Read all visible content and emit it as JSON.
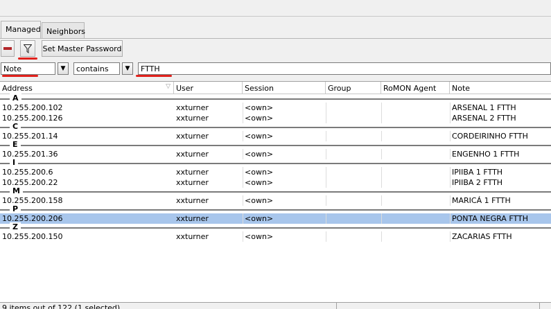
{
  "tabs": [
    {
      "label": "Managed",
      "active": true
    },
    {
      "label": "Neighbors",
      "active": false
    }
  ],
  "toolbar": {
    "remove_icon": "minus-icon",
    "filter_icon": "filter-funnel-icon",
    "master_password_label": "Set Master Password"
  },
  "filter": {
    "field": "Note",
    "operator": "contains",
    "value": "FTTH",
    "dropdown_icon": "dropdown-arrow-icon"
  },
  "table": {
    "columns": [
      "Address",
      "User",
      "Session",
      "Group",
      "RoMON Agent",
      "Note"
    ],
    "groups": [
      {
        "letter": "A",
        "rows": [
          {
            "address": "10.255.200.102",
            "user": "xxturner",
            "session": "<own>",
            "group": "",
            "romon": "",
            "note": "ARSENAL 1 FTTH"
          },
          {
            "address": "10.255.200.126",
            "user": "xxturner",
            "session": "<own>",
            "group": "",
            "romon": "",
            "note": "ARSENAL 2 FTTH"
          }
        ]
      },
      {
        "letter": "C",
        "rows": [
          {
            "address": "10.255.201.14",
            "user": "xxturner",
            "session": "<own>",
            "group": "",
            "romon": "",
            "note": "CORDEIRINHO  FTTH"
          }
        ]
      },
      {
        "letter": "E",
        "rows": [
          {
            "address": "10.255.201.36",
            "user": "xxturner",
            "session": "<own>",
            "group": "",
            "romon": "",
            "note": "ENGENHO 1 FTTH"
          }
        ]
      },
      {
        "letter": "I",
        "rows": [
          {
            "address": "10.255.200.6",
            "user": "xxturner",
            "session": "<own>",
            "group": "",
            "romon": "",
            "note": "IPIIBA  1 FTTH"
          },
          {
            "address": "10.255.200.22",
            "user": "xxturner",
            "session": "<own>",
            "group": "",
            "romon": "",
            "note": "IPIIBA  2 FTTH"
          }
        ]
      },
      {
        "letter": "M",
        "rows": [
          {
            "address": "10.255.200.158",
            "user": "xxturner",
            "session": "<own>",
            "group": "",
            "romon": "",
            "note": "MARICÁ 1 FTTH"
          }
        ]
      },
      {
        "letter": "P",
        "rows": [
          {
            "address": "10.255.200.206",
            "user": "xxturner",
            "session": "<own>",
            "group": "",
            "romon": "",
            "note": "PONTA NEGRA FTTH",
            "selected": true
          }
        ]
      },
      {
        "letter": "Z",
        "rows": [
          {
            "address": "10.255.200.150",
            "user": "xxturner",
            "session": "<own>",
            "group": "",
            "romon": "",
            "note": "ZACARIAS FTTH"
          }
        ]
      }
    ]
  },
  "status": {
    "text": "9 items out of 122 (1 selected)"
  },
  "colors": {
    "selected_row": "#a8c6ec",
    "annotation_underline": "#e0211c",
    "remove_icon": "#b3262a"
  }
}
